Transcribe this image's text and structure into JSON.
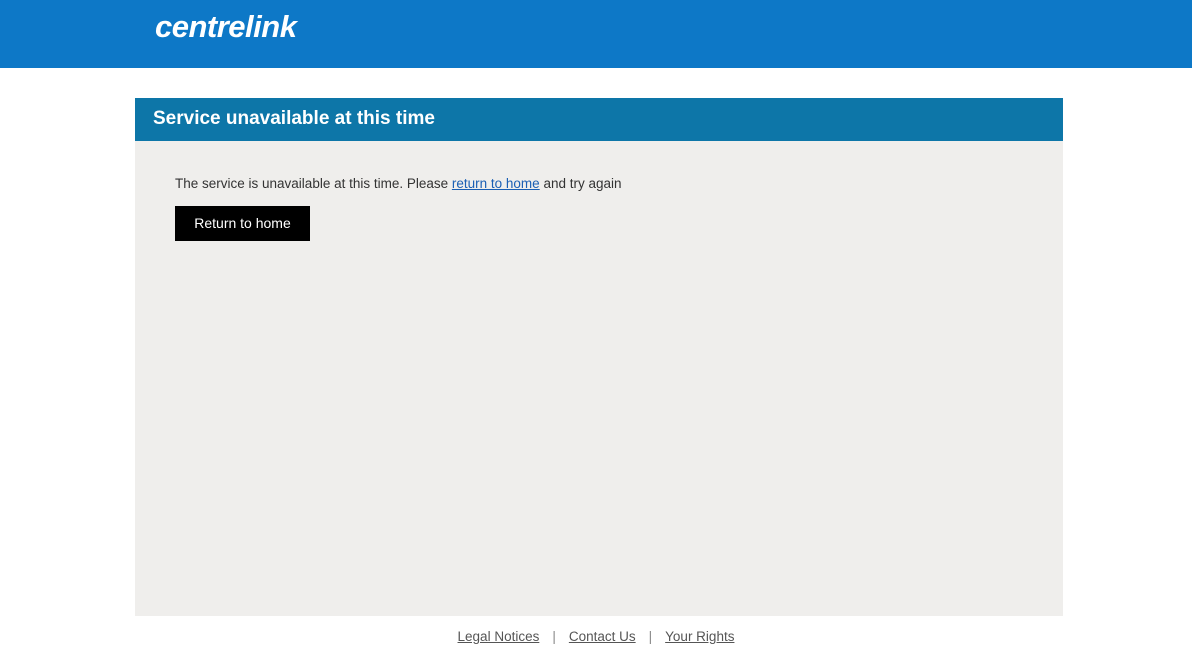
{
  "header": {
    "logo_text": "centrelink"
  },
  "panel": {
    "title": "Service unavailable at this time",
    "message_prefix": "The service is unavailable at this time. Please ",
    "message_link": "return to home",
    "message_suffix": " and try again",
    "button_label": "Return to home"
  },
  "footer": {
    "links": [
      {
        "label": "Legal Notices"
      },
      {
        "label": "Contact Us"
      },
      {
        "label": "Your Rights"
      }
    ],
    "separator": "|"
  },
  "colors": {
    "header_bg": "#0d78c7",
    "panel_header_bg": "#0d76a8",
    "panel_bg": "#efeeec",
    "button_bg": "#000000",
    "link": "#1a5fb4"
  }
}
